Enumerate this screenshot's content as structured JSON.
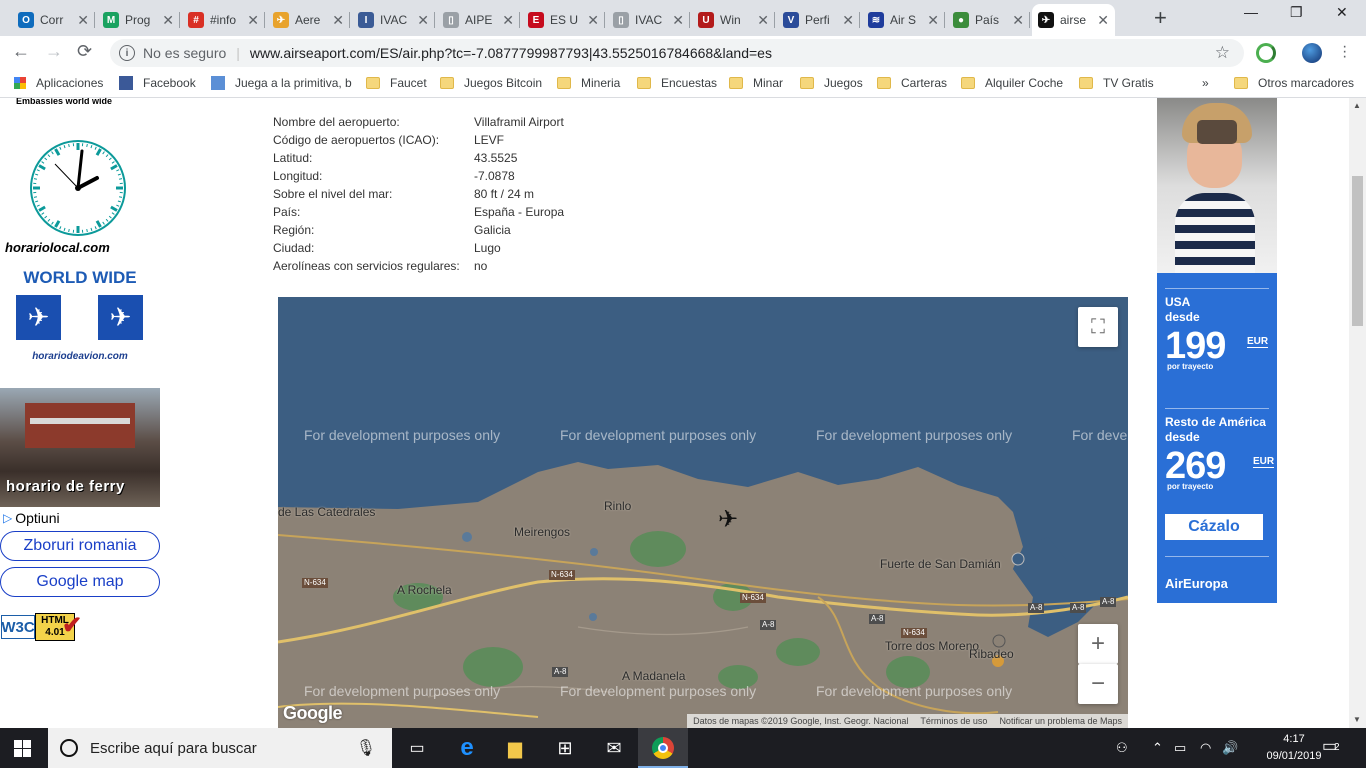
{
  "browser": {
    "tabs": [
      {
        "title": "Corr",
        "favicon": "outlook-icon",
        "color": "#0f6cbd",
        "glyph": "O"
      },
      {
        "title": "Prog",
        "favicon": "m-icon",
        "color": "#1aa260",
        "glyph": "M"
      },
      {
        "title": "#info",
        "favicon": "calendar-icon",
        "color": "#d93025",
        "glyph": "#"
      },
      {
        "title": "Aere",
        "favicon": "plane-icon",
        "color": "#e8a32d",
        "glyph": "✈"
      },
      {
        "title": "IVAC",
        "favicon": "ivao-icon",
        "color": "#3b5b96",
        "glyph": "I"
      },
      {
        "title": "AIPE",
        "favicon": "document-icon",
        "color": "#9aa0a6",
        "glyph": "▯"
      },
      {
        "title": "ES U",
        "favicon": "spain-flag-icon",
        "color": "#c60b1e",
        "glyph": "E"
      },
      {
        "title": "IVAC",
        "favicon": "document-icon",
        "color": "#9aa0a6",
        "glyph": "▯"
      },
      {
        "title": "Win",
        "favicon": "u-icon",
        "color": "#b31b1b",
        "glyph": "U"
      },
      {
        "title": "Perfi",
        "favicon": "v-icon",
        "color": "#2b4c9a",
        "glyph": "V"
      },
      {
        "title": "Air S",
        "favicon": "airline-icon",
        "color": "#1f3c9c",
        "glyph": "≋"
      },
      {
        "title": "País",
        "favicon": "globe-icon",
        "color": "#3c8d3c",
        "glyph": "●"
      },
      {
        "title": "airse",
        "favicon": "airseaport-icon",
        "color": "#111111",
        "glyph": "✈"
      }
    ],
    "active_tab": 12,
    "new_tab": "+",
    "window_controls": {
      "minimize": "—",
      "maximize": "❐",
      "close": "✕"
    },
    "security_label": "No es seguro",
    "url": "www.airseaport.com/ES/air.php?tc=-7.0877799987793|43.5525016784668&land=es"
  },
  "bookmarks": [
    {
      "label": "Aplicaciones",
      "icon": "apps-grid-icon"
    },
    {
      "label": "Facebook",
      "icon": "facebook-icon"
    },
    {
      "label": "Juega a la primitiva, b",
      "icon": "lottery-icon"
    },
    {
      "label": "Faucet",
      "icon": "folder-icon"
    },
    {
      "label": "Juegos Bitcoin",
      "icon": "folder-icon"
    },
    {
      "label": "Mineria",
      "icon": "folder-icon"
    },
    {
      "label": "Encuestas",
      "icon": "folder-icon"
    },
    {
      "label": "Minar",
      "icon": "folder-icon"
    },
    {
      "label": "Juegos",
      "icon": "folder-icon"
    },
    {
      "label": "Carteras",
      "icon": "folder-icon"
    },
    {
      "label": "Alquiler Coche",
      "icon": "folder-icon"
    },
    {
      "label": "TV Gratis",
      "icon": "folder-icon"
    }
  ],
  "bookmarks_overflow": "»",
  "bookmarks_other": "Otros marcadores",
  "left_sidebar": {
    "clock_caption": "Embassies world wide",
    "clock_brand": "horariolocal.com",
    "worldwide_title": "WORLD WIDE",
    "worldwide_brand": "horariodeavion.com",
    "ferry_label": "horario de ferry",
    "options_label": "Optiuni",
    "buttons": [
      "Zboruri romania",
      "Google map"
    ],
    "w3c_badge": {
      "w3c": "W3C",
      "html": "HTML 4.01"
    }
  },
  "airport_info": [
    {
      "key": "Nombre del aeropuerto:",
      "value": "Villaframil Airport"
    },
    {
      "key": "Código de aeropuertos (ICAO):",
      "value": "LEVF"
    },
    {
      "key": "Latitud:",
      "value": "43.5525"
    },
    {
      "key": "Longitud:",
      "value": "-7.0878"
    },
    {
      "key": "Sobre el nivel del mar:",
      "value": "80 ft / 24 m"
    },
    {
      "key": "País:",
      "value": "España - Europa"
    },
    {
      "key": "Región:",
      "value": "Galicia"
    },
    {
      "key": "Ciudad:",
      "value": "Lugo"
    },
    {
      "key": "Aerolíneas con servicios regulares:",
      "value": "no"
    }
  ],
  "map": {
    "watermark": "For development purposes only",
    "places": [
      "Rinlo",
      "Meirengos",
      "de Las Catedrales",
      "A Rochela",
      "Fuerte de San Damián",
      "Torre dos Moreno",
      "Ribadeo",
      "A Madanela"
    ],
    "roads": [
      "N-634",
      "N-634",
      "N-634",
      "A-8",
      "A-8",
      "A-8",
      "N-634",
      "A-8",
      "A-8",
      "A-8"
    ],
    "logo": "Google",
    "attribution": [
      "Datos de mapas ©2019 Google, Inst. Geogr. Nacional",
      "Términos de uso",
      "Notificar un problema de Maps"
    ],
    "zoom_in": "+",
    "zoom_out": "−",
    "fullscreen": "⛶",
    "colors": {
      "sea": "#3c5e82",
      "land": "#8c8276",
      "green": "#5f8b5c"
    }
  },
  "ad": {
    "dest1": "USA",
    "from1": "desde",
    "price1": "199",
    "currency": "EUR",
    "per_trip": "por trayecto",
    "dest2": "Resto de América",
    "from2": "desde",
    "price2": "269",
    "cta": "Cázalo",
    "brand": "AirEuropa"
  },
  "taskbar": {
    "search_placeholder": "Escribe aquí para buscar",
    "time": "4:17",
    "date": "09/01/2019",
    "notifications": "2"
  }
}
